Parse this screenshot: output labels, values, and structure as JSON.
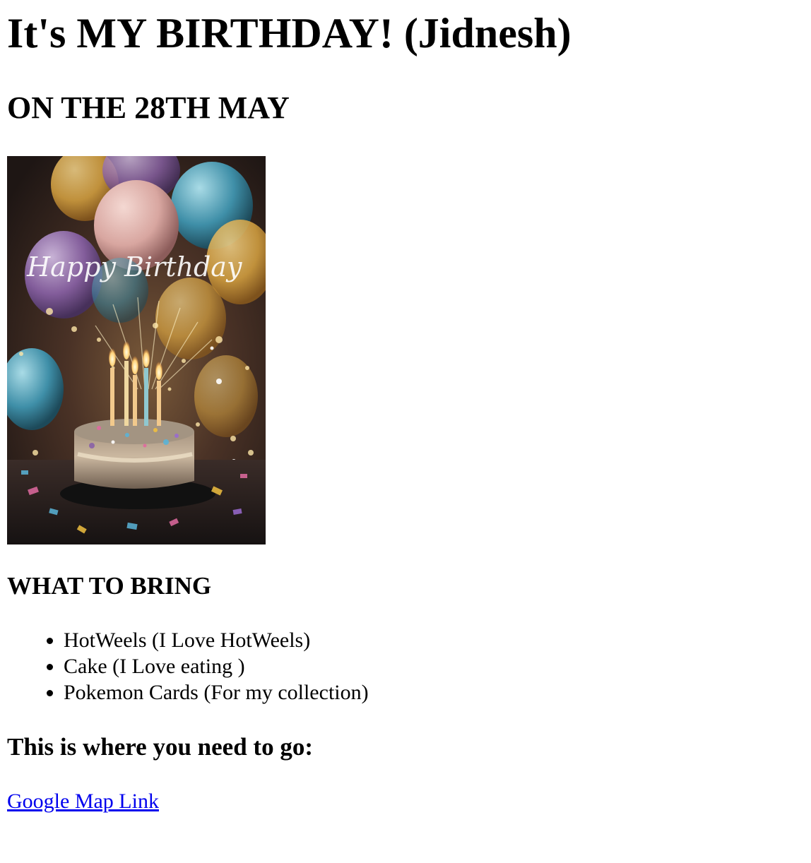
{
  "header": {
    "title": "It's MY BIRTHDAY! (Jidnesh)",
    "subtitle": "ON THE 28TH MAY"
  },
  "card_image": {
    "caption_text": "Happy Birthday",
    "colors": {
      "background": "#2a1d1a",
      "balloon_gold": "#d9a441",
      "balloon_pink": "#d8a6a0",
      "balloon_teal": "#3f8fa8",
      "balloon_purple": "#8a62a8",
      "cake": "#8a7866"
    }
  },
  "bring_section": {
    "heading": "WHAT TO BRING",
    "items": [
      "HotWeels (I Love HotWeels)",
      "Cake (I Love eating )",
      "Pokemon Cards (For my collection)"
    ]
  },
  "location_section": {
    "heading": "This is where you need to go:",
    "link_text": "Google Map Link"
  }
}
